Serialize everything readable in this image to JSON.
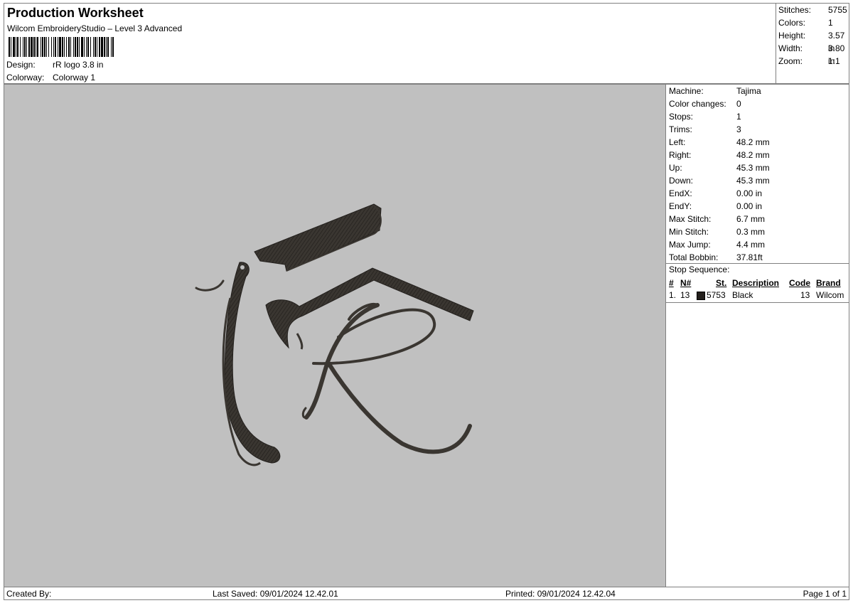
{
  "header": {
    "title": "Production Worksheet",
    "software": "Wilcom EmbroideryStudio – Level 3 Advanced",
    "design_label": "Design:",
    "design_value": "rR logo 3.8 in",
    "colorway_label": "Colorway:",
    "colorway_value": "Colorway 1"
  },
  "summary": [
    {
      "label": "Stitches:",
      "value": "5755"
    },
    {
      "label": "Colors:",
      "value": "1"
    },
    {
      "label": "Height:",
      "value": "3.57 in"
    },
    {
      "label": "Width:",
      "value": "3.80 in"
    },
    {
      "label": "Zoom:",
      "value": "1:1"
    }
  ],
  "parameters": [
    {
      "label": "Machine:",
      "value": "Tajima"
    },
    {
      "label": "Color changes:",
      "value": "0"
    },
    {
      "label": "Stops:",
      "value": "1"
    },
    {
      "label": "Trims:",
      "value": "3"
    },
    {
      "label": "Left:",
      "value": "48.2 mm"
    },
    {
      "label": "Right:",
      "value": "48.2 mm"
    },
    {
      "label": "Up:",
      "value": "45.3 mm"
    },
    {
      "label": "Down:",
      "value": "45.3 mm"
    },
    {
      "label": "EndX:",
      "value": "0.00 in"
    },
    {
      "label": "EndY:",
      "value": "0.00 in"
    },
    {
      "label": "Max Stitch:",
      "value": "6.7 mm"
    },
    {
      "label": "Min Stitch:",
      "value": "0.3 mm"
    },
    {
      "label": "Max Jump:",
      "value": "4.4 mm"
    },
    {
      "label": "Total Bobbin:",
      "value": "37.81ft"
    }
  ],
  "stop_sequence": {
    "title": "Stop Sequence:",
    "columns": {
      "index": "#",
      "needle": "N#",
      "stitches": "St.",
      "description": "Description",
      "code": "Code",
      "brand": "Brand"
    },
    "rows": [
      {
        "index": "1.",
        "needle": "13",
        "stitches": "5753",
        "description": "Black",
        "code": "13",
        "brand": "Wilcom",
        "color": "#231f1c"
      }
    ]
  },
  "footer": {
    "created_by": "Created By:",
    "last_saved": "Last Saved: 09/01/2024 12.42.01",
    "printed": "Printed: 09/01/2024 12.42.04",
    "page": "Page 1 of 1"
  },
  "colors": {
    "preview_background": "#c0c0c0",
    "thread": "#3a3631",
    "thread_dark": "#24211e"
  }
}
